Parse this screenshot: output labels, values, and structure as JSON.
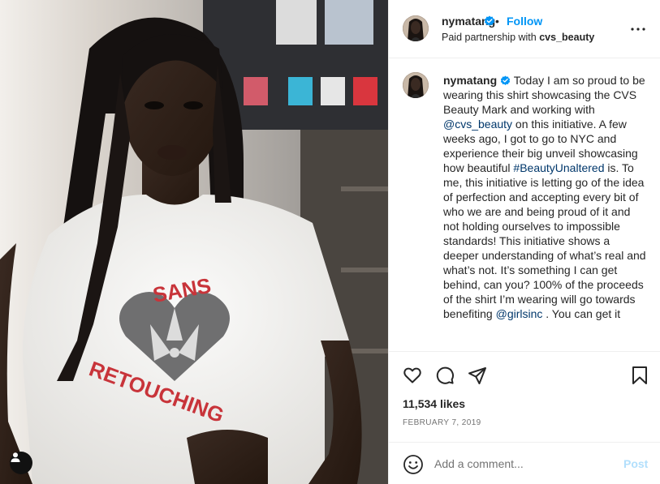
{
  "post": {
    "username": "nymatang",
    "follow_label": "Follow",
    "dot": "•",
    "partnership_prefix": "Paid partnership with",
    "partner": "cvs_beauty",
    "shirt_text_top": "SANS",
    "shirt_text_bottom": "RETOUCHING"
  },
  "caption": {
    "username": "nymatang",
    "text_1": " Today I am so proud to be wearing this shirt showcasing the CVS Beauty Mark and working with ",
    "mention_1": "@cvs_beauty",
    "text_2": " on this initiative.  A few weeks ago, I got to go to NYC and experience their big unveil showcasing how beautiful ",
    "hashtag_1": "#BeautyUnaltered",
    "text_3": " is. To me, this initiative is letting go of the idea of perfection and accepting every bit of who we are and being proud of it and not holding ourselves to impossible standards! This initiative shows a deeper understanding of what’s real and what’s not. It’s something I can get behind, can you? 100% of the proceeds of the shirt I’m wearing will go towards benefiting ",
    "mention_2": "@girlsinc",
    "text_4": " . You can get it"
  },
  "stats": {
    "likes": "11,534 likes",
    "date": "FEBRUARY 7, 2019"
  },
  "comment": {
    "placeholder": "Add a comment...",
    "post_label": "Post"
  },
  "icons": {
    "header_more": "more-horizontal-icon",
    "verified": "verified-badge-icon",
    "like": "heart-icon",
    "comment": "comment-icon",
    "share": "share-icon",
    "save": "bookmark-icon",
    "emoji": "emoji-icon",
    "tag": "user-tag-icon"
  },
  "colors": {
    "link": "#0095f6",
    "mention": "#00376b",
    "post_disabled": "#b2dffc",
    "shirt_print_red": "#c8343a"
  }
}
